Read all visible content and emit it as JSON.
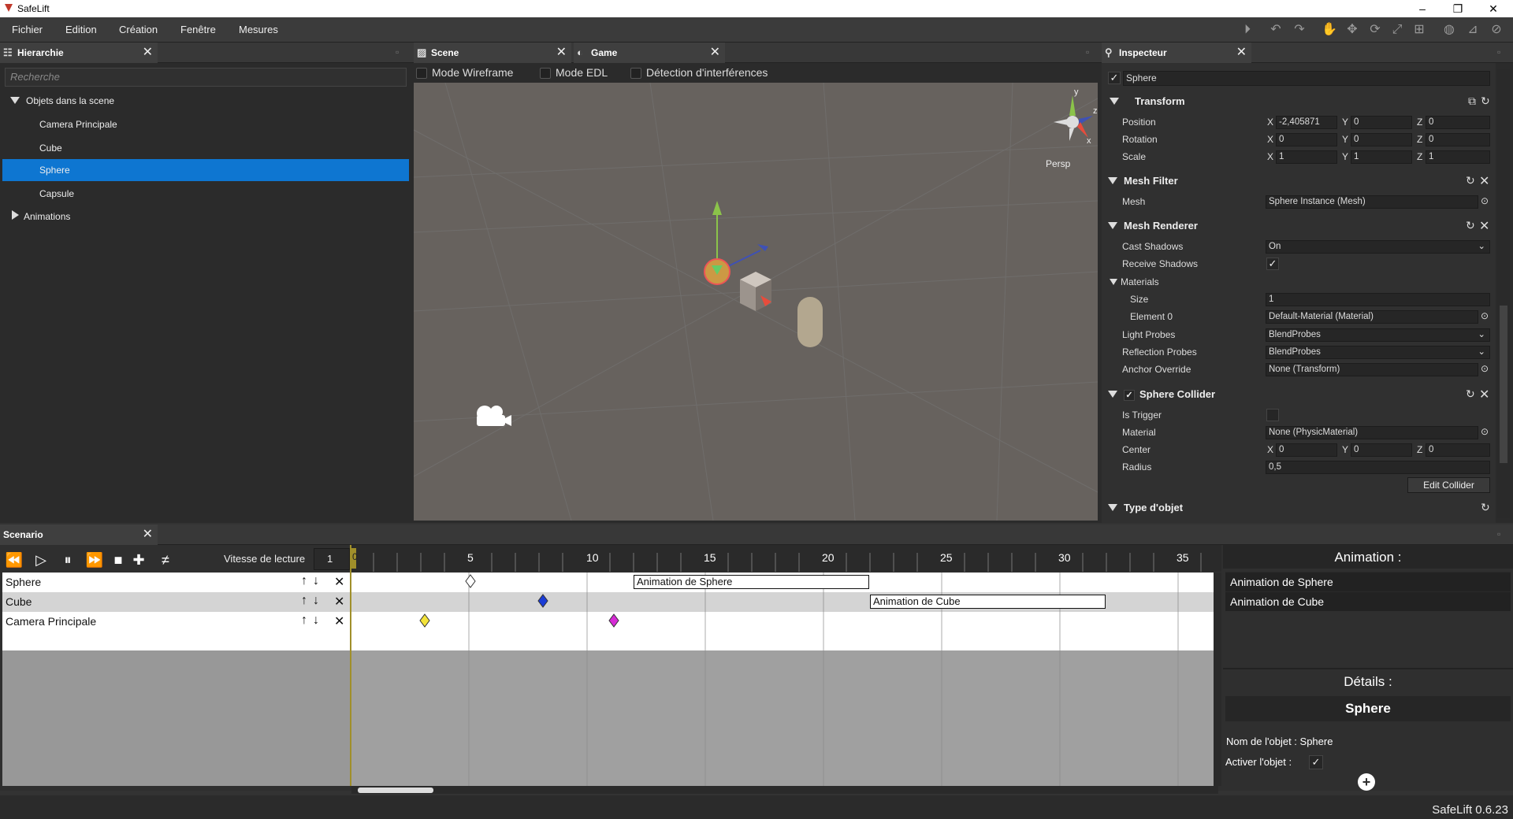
{
  "app": {
    "title": "SafeLift",
    "version": "SafeLift 0.6.23"
  },
  "menu": [
    "Fichier",
    "Edition",
    "Création",
    "Fenêtre",
    "Mesures"
  ],
  "hierarchy": {
    "tab": "Hierarchie",
    "search_placeholder": "Recherche",
    "root": "Objets dans la scene",
    "items": [
      "Camera Principale",
      "Cube",
      "Sphere",
      "Capsule"
    ],
    "selected": "Sphere",
    "animations": "Animations"
  },
  "scene": {
    "tabs": [
      "Scene",
      "Game"
    ],
    "options": [
      "Mode Wireframe",
      "Mode EDL",
      "Détection d'interférences"
    ],
    "gizmo_label": "Persp",
    "axis_y": "y",
    "axis_z": "z",
    "axis_x": "x"
  },
  "inspector": {
    "tab": "Inspecteur",
    "object_name": "Sphere",
    "transform": {
      "title": "Transform",
      "rows": [
        {
          "label": "Position",
          "x": "-2,405871",
          "y": "0",
          "z": "0"
        },
        {
          "label": "Rotation",
          "x": "0",
          "y": "0",
          "z": "0"
        },
        {
          "label": "Scale",
          "x": "1",
          "y": "1",
          "z": "1"
        }
      ],
      "axis_x": "X",
      "axis_y": "Y",
      "axis_z": "Z"
    },
    "mesh_filter": {
      "title": "Mesh Filter",
      "mesh_label": "Mesh",
      "mesh_value": "Sphere Instance (Mesh)"
    },
    "mesh_renderer": {
      "title": "Mesh Renderer",
      "cast_shadows_label": "Cast Shadows",
      "cast_shadows_value": "On",
      "receive_shadows_label": "Receive Shadows",
      "materials_label": "Materials",
      "size_label": "Size",
      "size_value": "1",
      "element0_label": "Element 0",
      "element0_value": "Default-Material (Material)",
      "light_probes_label": "Light Probes",
      "light_probes_value": "BlendProbes",
      "reflection_probes_label": "Reflection Probes",
      "reflection_probes_value": "BlendProbes",
      "anchor_override_label": "Anchor Override",
      "anchor_override_value": "None (Transform)"
    },
    "sphere_collider": {
      "title": "Sphere Collider",
      "is_trigger_label": "Is Trigger",
      "material_label": "Material",
      "material_value": "None (PhysicMaterial)",
      "center_label": "Center",
      "center_x": "0",
      "center_y": "0",
      "center_z": "0",
      "radius_label": "Radius",
      "radius_value": "0,5",
      "edit_button": "Edit Collider"
    },
    "type_objet": {
      "title": "Type d'objet"
    }
  },
  "scenario": {
    "tab": "Scenario",
    "speed_label": "Vitesse de lecture",
    "speed_value": "1",
    "ticks": [
      "0",
      "5",
      "10",
      "15",
      "20",
      "25",
      "30",
      "35"
    ],
    "tracks": [
      {
        "name": "Sphere",
        "bar": "Animation de Sphere"
      },
      {
        "name": "Cube",
        "bar": "Animation de Cube"
      },
      {
        "name": "Camera Principale",
        "bar": ""
      }
    ],
    "animation_title": "Animation :",
    "animations": [
      "Animation de Sphere",
      "Animation de Cube"
    ],
    "details_title": "Détails :",
    "details_object": "Sphere",
    "object_name_label": "Nom de l'objet : Sphere",
    "activate_label": "Activer l'objet :"
  },
  "colors": {
    "selection": "#0e76d1",
    "scene_bg": "#67625e"
  }
}
